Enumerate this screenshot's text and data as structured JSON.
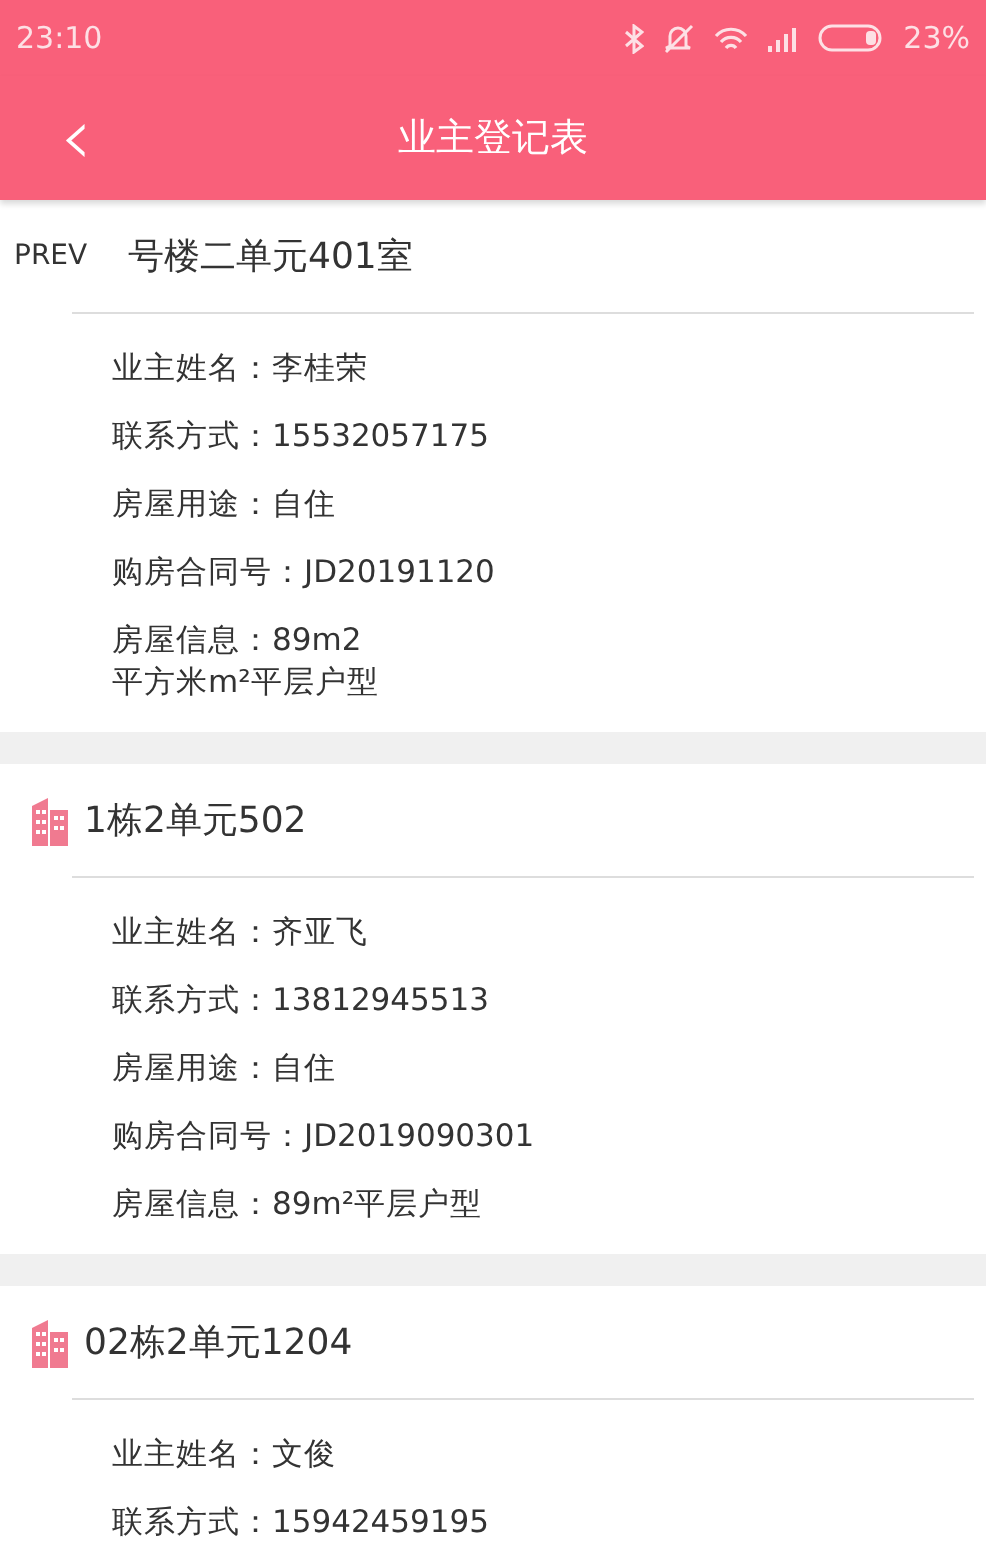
{
  "status_bar": {
    "time": "23:10",
    "battery": "23%"
  },
  "header": {
    "back": "‹",
    "title": "业主登记表"
  },
  "cards": [
    {
      "prev_label": "PREV",
      "title": "号楼二单元401室",
      "fields": [
        "业主姓名：李桂荣",
        "联系方式：15532057175",
        "房屋用途：自住",
        "购房合同号：JD20191120",
        "房屋信息：89m2\n平方米m²平层户型"
      ]
    },
    {
      "title": "1栋2单元502",
      "fields": [
        "业主姓名：齐亚飞",
        "联系方式：13812945513",
        "房屋用途：自住",
        "购房合同号：JD2019090301",
        "房屋信息：89m²平层户型"
      ]
    },
    {
      "title": "02栋2单元1204",
      "fields": [
        "业主姓名：文俊",
        "联系方式：15942459195"
      ]
    }
  ]
}
